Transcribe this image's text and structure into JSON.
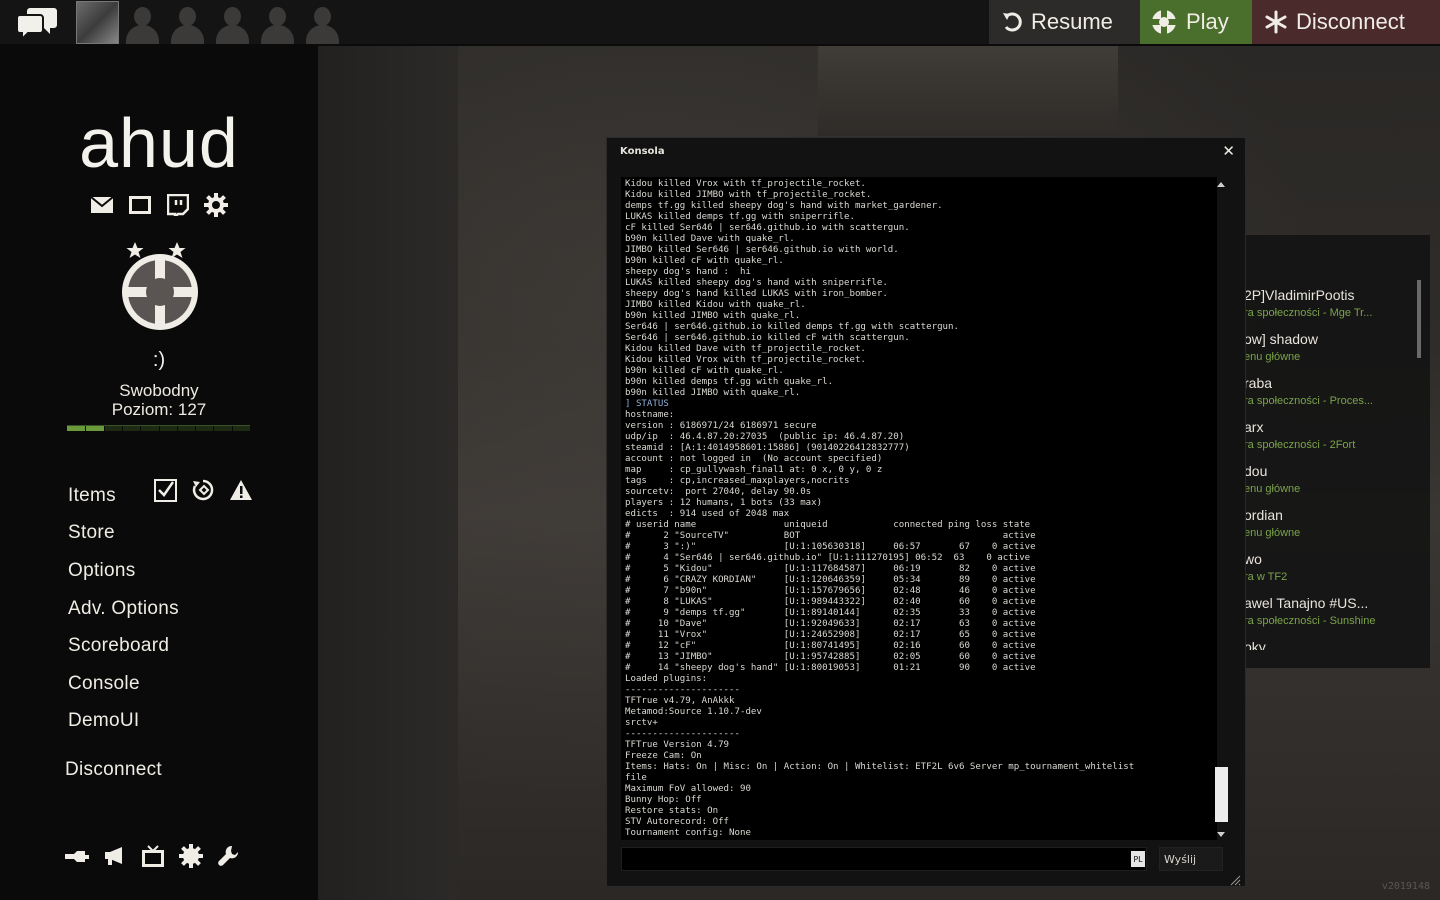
{
  "topbar": {
    "resume_label": "Resume",
    "play_label": "Play",
    "disconnect_label": "Disconnect",
    "colors": {
      "play_bg": "#4a6e2c",
      "disconnect_bg": "#4a2a2a",
      "resume_bg": "#2c2b29"
    }
  },
  "sidebar": {
    "logo": "ahud",
    "status_face": ":)",
    "status_text": "Swobodny",
    "level_text": "Poziom: 127",
    "level_progress": 0.2,
    "menu": [
      {
        "label": "Items"
      },
      {
        "label": "Store"
      },
      {
        "label": "Options"
      },
      {
        "label": "Adv. Options"
      },
      {
        "label": "Scoreboard"
      },
      {
        "label": "Console"
      },
      {
        "label": "DemoUI"
      }
    ],
    "disconnect_label": "Disconnect",
    "icons": {
      "social": [
        "mail-icon",
        "screen-icon",
        "twitch-icon",
        "gear-icon"
      ],
      "items": [
        "checkbox-icon",
        "trade-icon",
        "warning-icon"
      ],
      "bottom": [
        "workshop-icon",
        "megaphone-icon",
        "tv-icon",
        "settings-cog-icon",
        "wrench-icon"
      ]
    }
  },
  "friends": [
    {
      "name": "2P]VladimirPootis",
      "status": "ra społeczności - Mge Tr..."
    },
    {
      "name": "ow] shadow",
      "status": "enu główne"
    },
    {
      "name": "raba",
      "status": "ra społeczności - Proces..."
    },
    {
      "name": "arx",
      "status": "ra społeczności - 2Fort"
    },
    {
      "name": "dou",
      "status": "enu główne"
    },
    {
      "name": "ordian",
      "status": "enu główne"
    },
    {
      "name": "wo",
      "status": "ra w TF2"
    },
    {
      "name": "awel Tanajno #US...",
      "status": "ra społeczności - Sunshine"
    },
    {
      "name": "oky",
      "status": ""
    }
  ],
  "console": {
    "title": "Konsola",
    "lines": [
      "Kidou killed Vrox with tf_projectile_rocket.",
      "Kidou killed JIMBO with tf_projectile_rocket.",
      "demps tf.gg killed sheepy dog's hand with market_gardener.",
      "LUKAS killed demps tf.gg with sniperrifle.",
      "cF killed Ser646 | ser646.github.io with scattergun.",
      "b90n killed Dave with quake_rl.",
      "JIMBO killed Ser646 | ser646.github.io with world.",
      "b90n killed cF with quake_rl.",
      "sheepy dog's hand :  hi",
      "LUKAS killed sheepy dog's hand with sniperrifle.",
      "sheepy dog's hand killed LUKAS with iron_bomber.",
      "JIMBO killed Kidou with quake_rl.",
      "b90n killed JIMBO with quake_rl.",
      "Ser646 | ser646.github.io killed demps tf.gg with scattergun.",
      "Ser646 | ser646.github.io killed cF with scattergun.",
      "Kidou killed Dave with tf_projectile_rocket.",
      "Kidou killed Vrox with tf_projectile_rocket.",
      "b90n killed cF with quake_rl.",
      "b90n killed demps tf.gg with quake_rl.",
      "b90n killed JIMBO with quake_rl.",
      "] STATUS",
      "hostname: ",
      "version : 6186971/24 6186971 secure",
      "udp/ip  : 46.4.87.20:27035  (public ip: 46.4.87.20)",
      "steamid : [A:1:4014958601:15886] (90140226412832777)",
      "account : not logged in  (No account specified)",
      "map     : cp_gullywash_final1 at: 0 x, 0 y, 0 z",
      "tags    : cp,increased_maxplayers,nocrits",
      "sourcetv:  port 27040, delay 90.0s",
      "players : 12 humans, 1 bots (33 max)",
      "edicts  : 914 used of 2048 max",
      "# userid name                uniqueid            connected ping loss state",
      "#      2 \"SourceTV\"          BOT                                     active",
      "#      3 \":)\"                [U:1:105630318]     06:57       67    0 active",
      "#      4 \"Ser646 | ser646.github.io\" [U:1:111270195] 06:52  63    0 active",
      "#      5 \"Kidou\"             [U:1:117684587]     06:19       82    0 active",
      "#      6 \"CRAZY KORDIAN\"     [U:1:120646359]     05:34       89    0 active",
      "#      7 \"b90n\"              [U:1:157679656]     02:48       46    0 active",
      "#      8 \"LUKAS\"             [U:1:989443322]     02:40       60    0 active",
      "#      9 \"demps tf.gg\"       [U:1:89140144]      02:35       33    0 active",
      "#     10 \"Dave\"              [U:1:92049633]      02:17       63    0 active",
      "#     11 \"Vrox\"              [U:1:24652908]      02:17       65    0 active",
      "#     12 \"cF\"                [U:1:80741495]      02:16       60    0 active",
      "#     13 \"JIMBO\"             [U:1:95742885]      02:05       60    0 active",
      "#     14 \"sheepy dog's hand\" [U:1:80019053]      01:21       90    0 active",
      "Loaded plugins:",
      "---------------------",
      "TFTrue v4.79, AnAkkk",
      "Metamod:Source 1.10.7-dev",
      "srctv+",
      "---------------------",
      "TFTrue Version 4.79",
      "Freeze Cam: On",
      "Items: Hats: On | Misc: On | Action: On | Whitelist: ETF2L 6v6 Server mp_tournament_whitelist",
      "file",
      "Maximum FoV allowed: 90",
      "Bunny Hop: Off",
      "Restore stats: On",
      "STV Autorecord: Off",
      "Tournament config: None"
    ],
    "input_value": "",
    "lang_badge": "PL",
    "send_label": "Wyślij"
  },
  "build_tag": "v2019148"
}
